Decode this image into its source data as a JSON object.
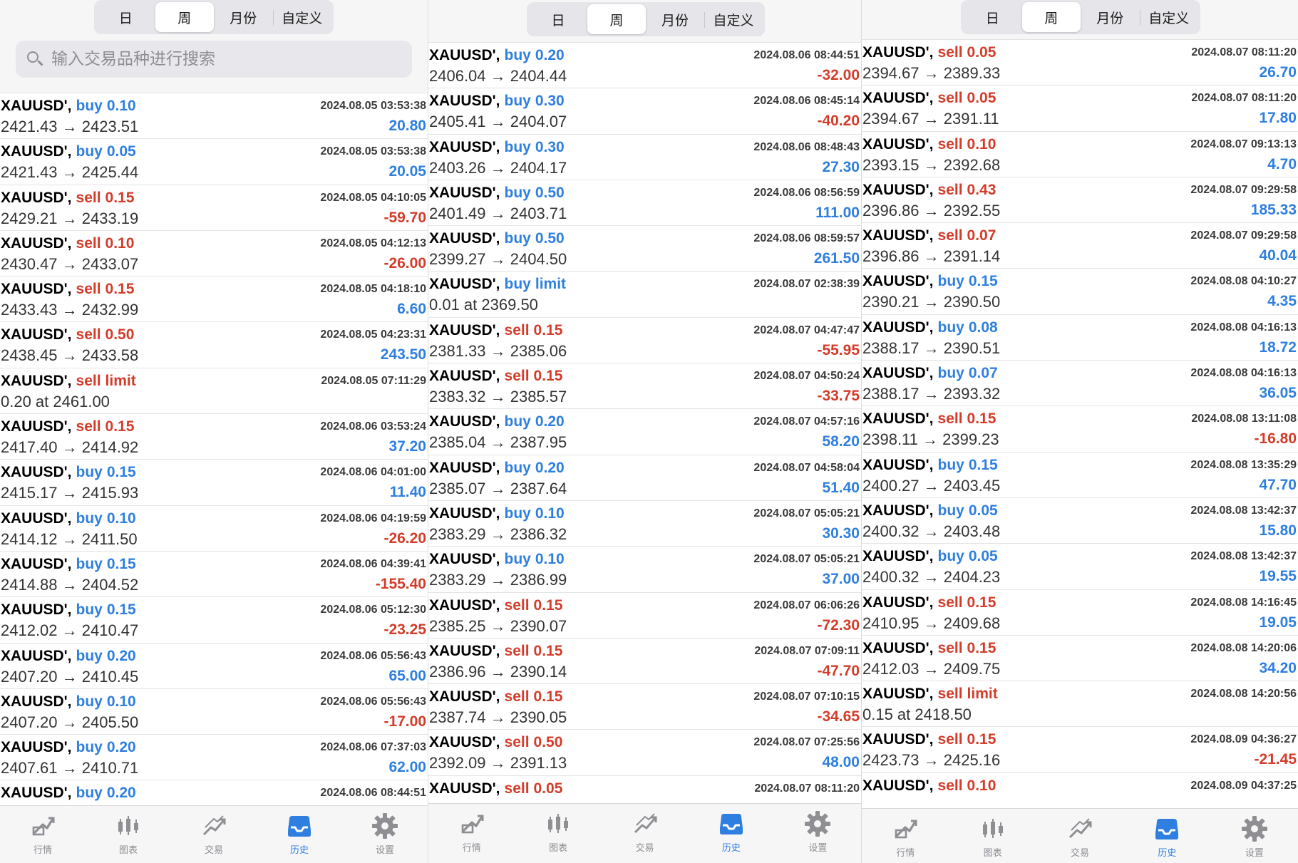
{
  "segments": [
    "日",
    "周",
    "月份",
    "自定义"
  ],
  "active_segment": 1,
  "search": {
    "placeholder": "输入交易品种进行搜索"
  },
  "tabs": [
    {
      "label": "行情",
      "icon": "chart-line-icon"
    },
    {
      "label": "图表",
      "icon": "candlestick-icon"
    },
    {
      "label": "交易",
      "icon": "trade-icon"
    },
    {
      "label": "历史",
      "icon": "history-inbox-icon"
    },
    {
      "label": "设置",
      "icon": "gear-icon"
    }
  ],
  "active_tab": 3,
  "colors": {
    "buy": "#2f7fe0",
    "sell": "#d43c2a",
    "inactive_icon": "#8e8e93"
  },
  "panels": [
    {
      "trades": [
        {
          "symbol": "XAUUSD'",
          "side": "buy",
          "volume": "0.10",
          "time": "2024.08.05 03:53:38",
          "prices": "2421.43 → 2423.51",
          "profit": "20.80"
        },
        {
          "symbol": "XAUUSD'",
          "side": "buy",
          "volume": "0.05",
          "time": "2024.08.05 03:53:38",
          "prices": "2421.43 → 2425.44",
          "profit": "20.05"
        },
        {
          "symbol": "XAUUSD'",
          "side": "sell",
          "volume": "0.15",
          "time": "2024.08.05 04:10:05",
          "prices": "2429.21 → 2433.19",
          "profit": "-59.70"
        },
        {
          "symbol": "XAUUSD'",
          "side": "sell",
          "volume": "0.10",
          "time": "2024.08.05 04:12:13",
          "prices": "2430.47 → 2433.07",
          "profit": "-26.00"
        },
        {
          "symbol": "XAUUSD'",
          "side": "sell",
          "volume": "0.15",
          "time": "2024.08.05 04:18:10",
          "prices": "2433.43 → 2432.99",
          "profit": "6.60"
        },
        {
          "symbol": "XAUUSD'",
          "side": "sell",
          "volume": "0.50",
          "time": "2024.08.05 04:23:31",
          "prices": "2438.45 → 2433.58",
          "profit": "243.50"
        },
        {
          "symbol": "XAUUSD'",
          "side": "sell",
          "volume": "limit",
          "time": "2024.08.05 07:11:29",
          "prices": "0.20 at 2461.00",
          "profit": ""
        },
        {
          "symbol": "XAUUSD'",
          "side": "sell",
          "volume": "0.15",
          "time": "2024.08.06 03:53:24",
          "prices": "2417.40 → 2414.92",
          "profit": "37.20"
        },
        {
          "symbol": "XAUUSD'",
          "side": "buy",
          "volume": "0.15",
          "time": "2024.08.06 04:01:00",
          "prices": "2415.17 → 2415.93",
          "profit": "11.40"
        },
        {
          "symbol": "XAUUSD'",
          "side": "buy",
          "volume": "0.10",
          "time": "2024.08.06 04:19:59",
          "prices": "2414.12 → 2411.50",
          "profit": "-26.20"
        },
        {
          "symbol": "XAUUSD'",
          "side": "buy",
          "volume": "0.15",
          "time": "2024.08.06 04:39:41",
          "prices": "2414.88 → 2404.52",
          "profit": "-155.40"
        },
        {
          "symbol": "XAUUSD'",
          "side": "buy",
          "volume": "0.15",
          "time": "2024.08.06 05:12:30",
          "prices": "2412.02 → 2410.47",
          "profit": "-23.25"
        },
        {
          "symbol": "XAUUSD'",
          "side": "buy",
          "volume": "0.20",
          "time": "2024.08.06 05:56:43",
          "prices": "2407.20 → 2410.45",
          "profit": "65.00"
        },
        {
          "symbol": "XAUUSD'",
          "side": "buy",
          "volume": "0.10",
          "time": "2024.08.06 05:56:43",
          "prices": "2407.20 → 2405.50",
          "profit": "-17.00"
        },
        {
          "symbol": "XAUUSD'",
          "side": "buy",
          "volume": "0.20",
          "time": "2024.08.06 07:37:03",
          "prices": "2407.61 → 2410.71",
          "profit": "62.00"
        },
        {
          "symbol": "XAUUSD'",
          "side": "buy",
          "volume": "0.20",
          "time": "2024.08.06 08:44:51",
          "prices": "",
          "profit": ""
        }
      ]
    },
    {
      "trades": [
        {
          "symbol": "XAUUSD'",
          "side": "buy",
          "volume": "0.20",
          "time": "2024.08.06 08:44:51",
          "prices": "2406.04 → 2404.44",
          "profit": "-32.00"
        },
        {
          "symbol": "XAUUSD'",
          "side": "buy",
          "volume": "0.30",
          "time": "2024.08.06 08:45:14",
          "prices": "2405.41 → 2404.07",
          "profit": "-40.20"
        },
        {
          "symbol": "XAUUSD'",
          "side": "buy",
          "volume": "0.30",
          "time": "2024.08.06 08:48:43",
          "prices": "2403.26 → 2404.17",
          "profit": "27.30"
        },
        {
          "symbol": "XAUUSD'",
          "side": "buy",
          "volume": "0.50",
          "time": "2024.08.06 08:56:59",
          "prices": "2401.49 → 2403.71",
          "profit": "111.00"
        },
        {
          "symbol": "XAUUSD'",
          "side": "buy",
          "volume": "0.50",
          "time": "2024.08.06 08:59:57",
          "prices": "2399.27 → 2404.50",
          "profit": "261.50"
        },
        {
          "symbol": "XAUUSD'",
          "side": "buy",
          "volume": "limit",
          "time": "2024.08.07 02:38:39",
          "prices": "0.01 at 2369.50",
          "profit": ""
        },
        {
          "symbol": "XAUUSD'",
          "side": "sell",
          "volume": "0.15",
          "time": "2024.08.07 04:47:47",
          "prices": "2381.33 → 2385.06",
          "profit": "-55.95"
        },
        {
          "symbol": "XAUUSD'",
          "side": "sell",
          "volume": "0.15",
          "time": "2024.08.07 04:50:24",
          "prices": "2383.32 → 2385.57",
          "profit": "-33.75"
        },
        {
          "symbol": "XAUUSD'",
          "side": "buy",
          "volume": "0.20",
          "time": "2024.08.07 04:57:16",
          "prices": "2385.04 → 2387.95",
          "profit": "58.20"
        },
        {
          "symbol": "XAUUSD'",
          "side": "buy",
          "volume": "0.20",
          "time": "2024.08.07 04:58:04",
          "prices": "2385.07 → 2387.64",
          "profit": "51.40"
        },
        {
          "symbol": "XAUUSD'",
          "side": "buy",
          "volume": "0.10",
          "time": "2024.08.07 05:05:21",
          "prices": "2383.29 → 2386.32",
          "profit": "30.30"
        },
        {
          "symbol": "XAUUSD'",
          "side": "buy",
          "volume": "0.10",
          "time": "2024.08.07 05:05:21",
          "prices": "2383.29 → 2386.99",
          "profit": "37.00"
        },
        {
          "symbol": "XAUUSD'",
          "side": "sell",
          "volume": "0.15",
          "time": "2024.08.07 06:06:26",
          "prices": "2385.25 → 2390.07",
          "profit": "-72.30"
        },
        {
          "symbol": "XAUUSD'",
          "side": "sell",
          "volume": "0.15",
          "time": "2024.08.07 07:09:11",
          "prices": "2386.96 → 2390.14",
          "profit": "-47.70"
        },
        {
          "symbol": "XAUUSD'",
          "side": "sell",
          "volume": "0.15",
          "time": "2024.08.07 07:10:15",
          "prices": "2387.74 → 2390.05",
          "profit": "-34.65"
        },
        {
          "symbol": "XAUUSD'",
          "side": "sell",
          "volume": "0.50",
          "time": "2024.08.07 07:25:56",
          "prices": "2392.09 → 2391.13",
          "profit": "48.00"
        },
        {
          "symbol": "XAUUSD'",
          "side": "sell",
          "volume": "0.05",
          "time": "2024.08.07 08:11:20",
          "prices": "",
          "profit": ""
        }
      ]
    },
    {
      "trades": [
        {
          "symbol": "XAUUSD'",
          "side": "sell",
          "volume": "0.05",
          "time": "2024.08.07 08:11:20",
          "prices": "2394.67 → 2389.33",
          "profit": "26.70"
        },
        {
          "symbol": "XAUUSD'",
          "side": "sell",
          "volume": "0.05",
          "time": "2024.08.07 08:11:20",
          "prices": "2394.67 → 2391.11",
          "profit": "17.80"
        },
        {
          "symbol": "XAUUSD'",
          "side": "sell",
          "volume": "0.10",
          "time": "2024.08.07 09:13:13",
          "prices": "2393.15 → 2392.68",
          "profit": "4.70"
        },
        {
          "symbol": "XAUUSD'",
          "side": "sell",
          "volume": "0.43",
          "time": "2024.08.07 09:29:58",
          "prices": "2396.86 → 2392.55",
          "profit": "185.33"
        },
        {
          "symbol": "XAUUSD'",
          "side": "sell",
          "volume": "0.07",
          "time": "2024.08.07 09:29:58",
          "prices": "2396.86 → 2391.14",
          "profit": "40.04"
        },
        {
          "symbol": "XAUUSD'",
          "side": "buy",
          "volume": "0.15",
          "time": "2024.08.08 04:10:27",
          "prices": "2390.21 → 2390.50",
          "profit": "4.35"
        },
        {
          "symbol": "XAUUSD'",
          "side": "buy",
          "volume": "0.08",
          "time": "2024.08.08 04:16:13",
          "prices": "2388.17 → 2390.51",
          "profit": "18.72"
        },
        {
          "symbol": "XAUUSD'",
          "side": "buy",
          "volume": "0.07",
          "time": "2024.08.08 04:16:13",
          "prices": "2388.17 → 2393.32",
          "profit": "36.05"
        },
        {
          "symbol": "XAUUSD'",
          "side": "sell",
          "volume": "0.15",
          "time": "2024.08.08 13:11:08",
          "prices": "2398.11 → 2399.23",
          "profit": "-16.80"
        },
        {
          "symbol": "XAUUSD'",
          "side": "buy",
          "volume": "0.15",
          "time": "2024.08.08 13:35:29",
          "prices": "2400.27 → 2403.45",
          "profit": "47.70"
        },
        {
          "symbol": "XAUUSD'",
          "side": "buy",
          "volume": "0.05",
          "time": "2024.08.08 13:42:37",
          "prices": "2400.32 → 2403.48",
          "profit": "15.80"
        },
        {
          "symbol": "XAUUSD'",
          "side": "buy",
          "volume": "0.05",
          "time": "2024.08.08 13:42:37",
          "prices": "2400.32 → 2404.23",
          "profit": "19.55"
        },
        {
          "symbol": "XAUUSD'",
          "side": "sell",
          "volume": "0.15",
          "time": "2024.08.08 14:16:45",
          "prices": "2410.95 → 2409.68",
          "profit": "19.05"
        },
        {
          "symbol": "XAUUSD'",
          "side": "sell",
          "volume": "0.15",
          "time": "2024.08.08 14:20:06",
          "prices": "2412.03 → 2409.75",
          "profit": "34.20"
        },
        {
          "symbol": "XAUUSD'",
          "side": "sell",
          "volume": "limit",
          "time": "2024.08.08 14:20:56",
          "prices": "0.15 at 2418.50",
          "profit": ""
        },
        {
          "symbol": "XAUUSD'",
          "side": "sell",
          "volume": "0.15",
          "time": "2024.08.09 04:36:27",
          "prices": "2423.73 → 2425.16",
          "profit": "-21.45"
        },
        {
          "symbol": "XAUUSD'",
          "side": "sell",
          "volume": "0.10",
          "time": "2024.08.09 04:37:25",
          "prices": "",
          "profit": ""
        }
      ]
    }
  ]
}
